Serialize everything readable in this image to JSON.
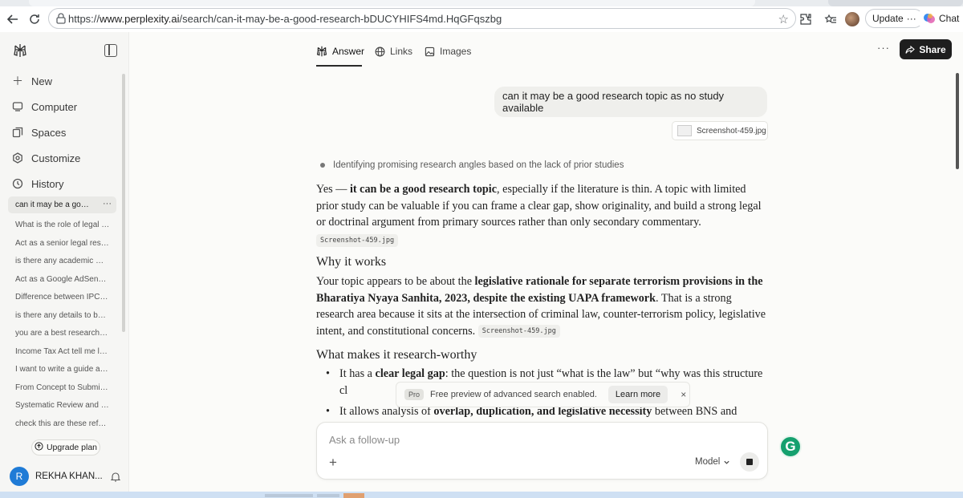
{
  "browser": {
    "url_prefix": "https://",
    "url_domain": "www.perplexity.ai",
    "url_path": "/search/can-it-may-be-a-good-research-bDUCYHIFS4md.HqGFqszbg",
    "update_label": "Update",
    "chat_label": "Chat"
  },
  "sidebar": {
    "nav": [
      {
        "label": "New",
        "icon": "plus-icon"
      },
      {
        "label": "Computer",
        "icon": "computer-icon"
      },
      {
        "label": "Spaces",
        "icon": "spaces-icon"
      },
      {
        "label": "Customize",
        "icon": "customize-icon"
      },
      {
        "label": "History",
        "icon": "history-icon"
      }
    ],
    "history_active": "can it may be a good research topic as no study available",
    "history": [
      "What is the role of legal r...",
      "Act as a senior legal rese...",
      "is there any academic mo...",
      "Act as a Google AdSense ...",
      "Difference between IPC a...",
      "is there any details to be ...",
      "you are a best researcher,...",
      "Income Tax Act tell me lat...",
      "I want to write a guide ab...",
      "From Concept to Submiss...",
      "Systematic Review and P...",
      "check this are these refer..."
    ],
    "upgrade_label": "Upgrade plan",
    "user_initial": "R",
    "user_name": "REKHA KHAN..."
  },
  "main": {
    "tabs": [
      {
        "label": "Answer",
        "icon": "perplexity-icon"
      },
      {
        "label": "Links",
        "icon": "globe-icon"
      },
      {
        "label": "Images",
        "icon": "image-icon"
      }
    ],
    "share_label": "Share",
    "more_label": "···",
    "user_query": "can it may be a good research topic as no study available",
    "attachment_name": "Screenshot-459.jpg",
    "step": "Identifying promising research angles based on the lack of prior studies",
    "answer": {
      "p1_a": "Yes — ",
      "p1_b": "it can be a good research topic",
      "p1_c": ", especially if the literature is thin. A topic with limited prior study can be valuable if you can frame a clear gap, show originality, and build a strong legal or doctrinal argument from primary sources rather than only secondary commentary.",
      "cite1": "Screenshot-459.jpg",
      "h_why": "Why it works",
      "p2_a": "Your topic appears to be about the ",
      "p2_b": "legislative rationale for separate terrorism provisions in the Bharatiya Nyaya Sanhita, 2023, despite the existing UAPA framework",
      "p2_c": ". That is a strong research area because it sits at the intersection of criminal law, counter-terrorism policy, legislative intent, and constitutional concerns.",
      "cite2": "Screenshot-459.jpg",
      "h_what": "What makes it research-worthy",
      "li1_a": "It has a ",
      "li1_b": "clear legal gap",
      "li1_c": ": the question is not just “what is the law” but “why was this structure cl",
      "li2_a": "It allows analysis of ",
      "li2_b": "overlap, duplication, and legislative necessity",
      "li2_c": " between BNS and"
    },
    "toast": {
      "badge": "Pro",
      "text": "Free preview of advanced search enabled.",
      "learn_more": "Learn more",
      "close": "×"
    },
    "composer": {
      "placeholder": "Ask a follow-up",
      "model_label": "Model"
    }
  }
}
